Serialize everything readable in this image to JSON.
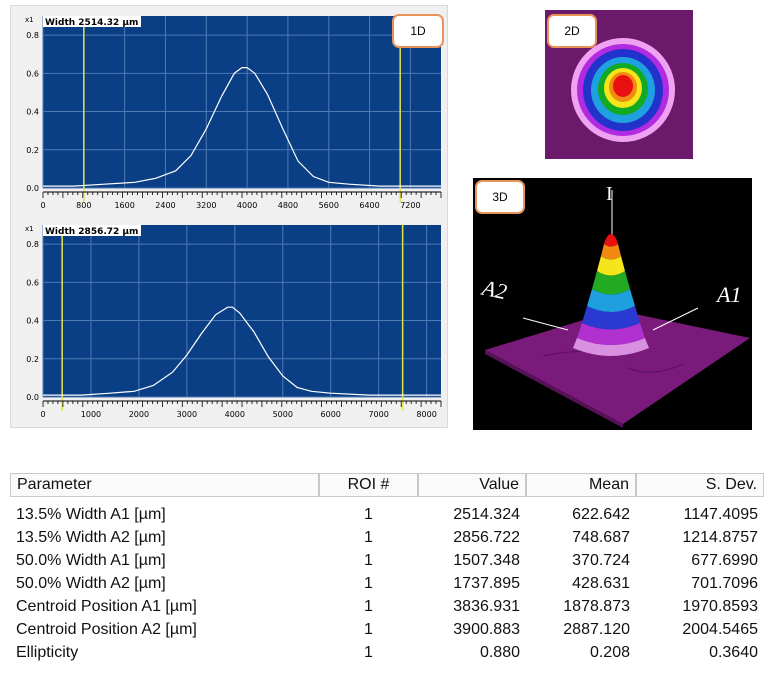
{
  "panels": {
    "oned_tag": "1D",
    "twod_tag": "2D",
    "threed_tag": "3D"
  },
  "chart_data": [
    {
      "type": "line",
      "title": "",
      "x_scale_label": "x1",
      "width_label": "Width 2514.32 µm",
      "y_ticks": [
        "0.0",
        "0.2",
        "0.4",
        "0.6",
        "0.8"
      ],
      "x_ticks": [
        "0",
        "800",
        "1600",
        "2400",
        "3200",
        "4000",
        "4800",
        "5600",
        "6400",
        "7200"
      ],
      "x_range": [
        0,
        7800
      ],
      "y_range": [
        0,
        0.9
      ],
      "cursor_x": [
        800,
        7000
      ],
      "series": [
        {
          "x": [
            0,
            600,
            1200,
            1800,
            2200,
            2600,
            2900,
            3200,
            3500,
            3750,
            3900,
            4000,
            4150,
            4400,
            4700,
            5000,
            5300,
            5600,
            6000,
            6600,
            7200,
            7800
          ],
          "values": [
            0.01,
            0.01,
            0.02,
            0.03,
            0.05,
            0.09,
            0.17,
            0.31,
            0.48,
            0.6,
            0.63,
            0.63,
            0.6,
            0.49,
            0.31,
            0.14,
            0.06,
            0.03,
            0.02,
            0.01,
            0.01,
            0.01
          ]
        }
      ],
      "colors": {
        "background": "#0a3f86",
        "grid": "#4f79b3",
        "cursor": "#e6e34a",
        "trace": "#ffffff"
      }
    },
    {
      "type": "line",
      "title": "",
      "x_scale_label": "x1",
      "width_label": "Width 2856.72 µm",
      "y_ticks": [
        "0.0",
        "0.2",
        "0.4",
        "0.6",
        "0.8"
      ],
      "x_ticks": [
        "0",
        "1000",
        "2000",
        "3000",
        "4000",
        "5000",
        "6000",
        "7000",
        "8000"
      ],
      "x_range": [
        0,
        8300
      ],
      "y_range": [
        0,
        0.9
      ],
      "cursor_x": [
        400,
        7500
      ],
      "series": [
        {
          "x": [
            0,
            800,
            1400,
            1900,
            2300,
            2700,
            3000,
            3300,
            3600,
            3850,
            3950,
            4100,
            4400,
            4700,
            5000,
            5300,
            5600,
            6000,
            6800,
            7600,
            8300
          ],
          "values": [
            0.01,
            0.01,
            0.02,
            0.03,
            0.06,
            0.13,
            0.22,
            0.33,
            0.43,
            0.47,
            0.47,
            0.44,
            0.34,
            0.21,
            0.11,
            0.05,
            0.03,
            0.02,
            0.01,
            0.01,
            0.01
          ]
        }
      ],
      "colors": {
        "background": "#0a3f86",
        "grid": "#4f79b3",
        "cursor": "#e6e34a",
        "trace": "#ffffff"
      }
    }
  ],
  "threed": {
    "axis_i": "I",
    "axis_a1": "A1",
    "axis_a2": "A2"
  },
  "table": {
    "headers": [
      "Parameter",
      "ROI #",
      "Value",
      "Mean",
      "S. Dev."
    ],
    "rows": [
      [
        "13.5% Width A1 [µm]",
        "1",
        "2514.324",
        "622.642",
        "1147.4095"
      ],
      [
        "13.5% Width A2 [µm]",
        "1",
        "2856.722",
        "748.687",
        "1214.8757"
      ],
      [
        "50.0% Width A1 [µm]",
        "1",
        "1507.348",
        "370.724",
        "677.6990"
      ],
      [
        "50.0% Width A2 [µm]",
        "1",
        "1737.895",
        "428.631",
        "701.7096"
      ],
      [
        "Centroid Position A1 [µm]",
        "1",
        "3836.931",
        "1878.873",
        "1970.8593"
      ],
      [
        "Centroid Position A2 [µm]",
        "1",
        "3900.883",
        "2887.120",
        "2004.5465"
      ],
      [
        "Ellipticity",
        "1",
        "0.880",
        "0.208",
        "0.3640"
      ]
    ]
  }
}
